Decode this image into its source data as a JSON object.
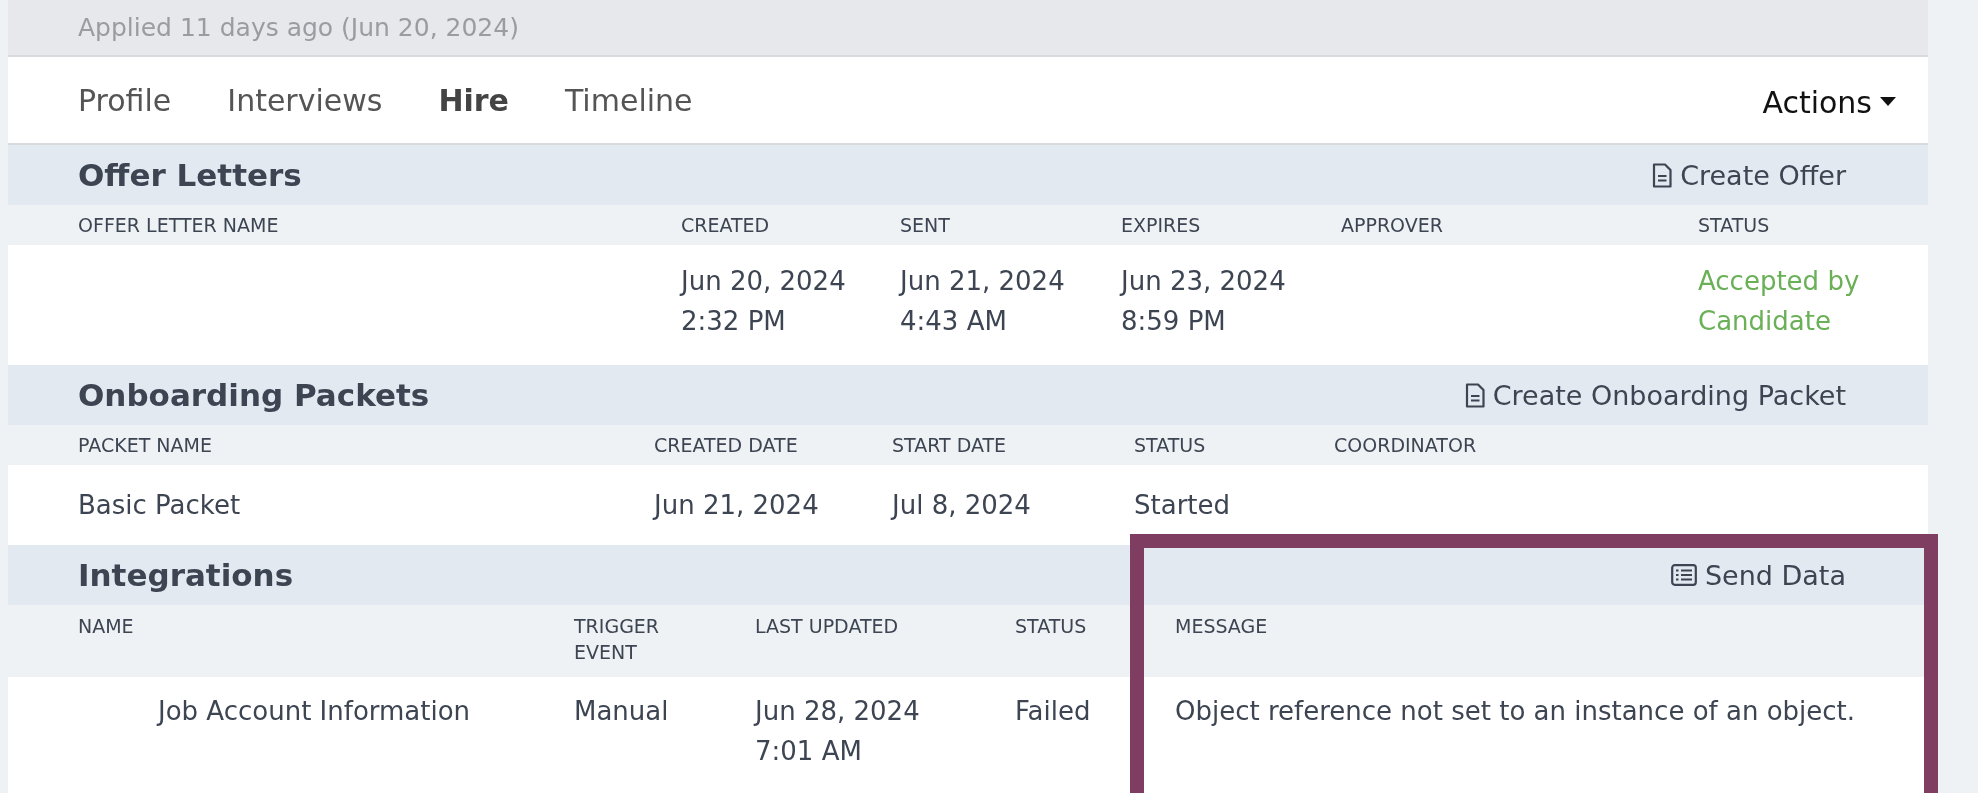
{
  "applied_note": "Applied 11 days ago (Jun 20, 2024)",
  "tabs": [
    {
      "label": "Profile",
      "selected": false
    },
    {
      "label": "Interviews",
      "selected": false
    },
    {
      "label": "Hire",
      "selected": true
    },
    {
      "label": "Timeline",
      "selected": false
    }
  ],
  "actions_menu": "Actions",
  "sections": [
    {
      "kind": "offers",
      "title": "Offer Letters",
      "action": "Create Offer",
      "columns": [
        "OFFER LETTER NAME",
        "CREATED",
        "SENT",
        "EXPIRES",
        "APPROVER",
        "STATUS"
      ],
      "rows": [
        {
          "cells": [
            null,
            {
              "text": "Jun 20, 2024\n2:32 PM"
            },
            {
              "text": "Jun 21, 2024\n4:43 AM"
            },
            {
              "text": "Jun 23, 2024\n8:59 PM"
            },
            null,
            {
              "text": "Accepted by\nCandidate",
              "color": "#6ab056"
            }
          ]
        }
      ]
    },
    {
      "kind": "packets",
      "title": "Onboarding Packets",
      "action": "Create Onboarding Packet",
      "columns": [
        "PACKET NAME",
        "CREATED DATE",
        "START DATE",
        "STATUS",
        "COORDINATOR"
      ],
      "rows": [
        {
          "cells": [
            {
              "text": "Basic Packet"
            },
            {
              "text": "Jun 21, 2024"
            },
            {
              "text": "Jul 8, 2024"
            },
            {
              "text": "Started"
            },
            null
          ]
        }
      ]
    },
    {
      "kind": "integrations",
      "title": "Integrations",
      "action": "Send Data",
      "highlight_message": true,
      "columns": [
        "NAME",
        "TRIGGER\nEVENT",
        "LAST UPDATED",
        "STATUS",
        "MESSAGE"
      ],
      "rows": [
        {
          "cells": [
            {
              "text": "Job Account Information"
            },
            {
              "text": "Manual"
            },
            {
              "text": "Jun 28, 2024\n7:01 AM"
            },
            {
              "text": "Failed"
            },
            {
              "text": "Object reference not set to an instance of an object."
            }
          ]
        }
      ]
    }
  ]
}
